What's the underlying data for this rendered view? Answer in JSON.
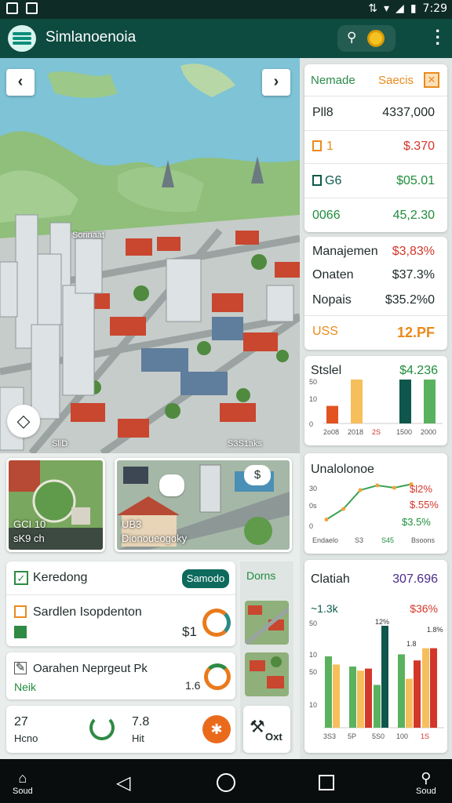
{
  "status_bar": {
    "time": "7:29"
  },
  "app": {
    "title": "Simlanoenoia"
  },
  "map": {
    "label_top": "Sorinaat",
    "label_bottom_left": "SliD",
    "label_bottom_right": "S3S1aks"
  },
  "summary_card": {
    "tab_left": "Nemade",
    "tab_right": "Saecis",
    "rows": [
      {
        "key": "Pll8",
        "value": "4337,000"
      },
      {
        "key": "1",
        "value": "$.370"
      },
      {
        "key": "G6",
        "value": "$05.01"
      },
      {
        "key": "0066",
        "value": "45,2.30"
      }
    ]
  },
  "finance_card": {
    "rows": [
      {
        "key": "Manajemen",
        "value": "$3,83%"
      },
      {
        "key": "Onaten",
        "value": "$37.3%"
      },
      {
        "key": "Nopais",
        "value": "$35.2%0"
      },
      {
        "key": "USS",
        "value": "12.PF"
      }
    ]
  },
  "bar_chart_card": {
    "chart_data": {
      "type": "bar",
      "title": "Stslel",
      "value_label": "$4.236",
      "categories": [
        "2o08",
        "2018",
        "2S",
        "1500",
        "2000"
      ],
      "values": [
        20,
        50,
        0,
        50,
        50
      ],
      "bar_colors": [
        "#e2531f",
        "#f6bf5c",
        "#ffffff",
        "#0f564c",
        "#5ab25e"
      ],
      "yticks": [
        "50",
        "10",
        "0"
      ]
    }
  },
  "line_chart_card": {
    "chart_data": {
      "type": "line",
      "title": "Unalolonoe",
      "x_labels": [
        "Endaelo",
        "S3",
        "S45",
        "Bsoons"
      ],
      "values": [
        5,
        14,
        30,
        34,
        32,
        35
      ],
      "yticks": [
        "30",
        "0s",
        "0"
      ],
      "annotations": [
        "$l2%",
        "$.55%",
        "$3.5%"
      ]
    }
  },
  "stacked_chart_card": {
    "chart_data": {
      "type": "bar",
      "title": "Clatiah",
      "value_right": "307.696",
      "sub_left": "~1.3k",
      "sub_right": "$36%",
      "categories": [
        "3S3",
        "5P",
        "5S0",
        "100",
        "1S"
      ],
      "yticks": [
        "50",
        "10",
        "50",
        "10"
      ],
      "top_labels": [
        "12%",
        "1.8",
        "1.8%"
      ],
      "series": [
        {
          "color": "#5ab25e",
          "values": [
            70,
            60,
            42,
            72,
            0
          ]
        },
        {
          "color": "#f6bf5c",
          "values": [
            62,
            56,
            0,
            48,
            78
          ]
        },
        {
          "color": "#d2372a",
          "values": [
            0,
            58,
            0,
            66,
            78
          ]
        },
        {
          "color": "#0f564c",
          "values": [
            0,
            0,
            100,
            0,
            0
          ]
        }
      ]
    }
  },
  "thumbs": {
    "left": {
      "line1": "GCI 10",
      "line2": "sK9 ch"
    },
    "middle": {
      "line1": "UB3",
      "line2": "Dionoueogoky"
    }
  },
  "list": {
    "header": {
      "label": "Keredong",
      "pill": "Samodo",
      "side": "Dorns"
    },
    "item1": {
      "title": "Sardlen Isopdenton",
      "value": "$1"
    },
    "item2": {
      "title": "Oarahen Neprgeut Pk",
      "sub": "Neik",
      "value": "1.6"
    },
    "item3": {
      "left_value": "27",
      "left_label": "Hcno",
      "mid_value": "7.8",
      "mid_label": "Hit"
    },
    "side_btn": "Oxt"
  },
  "bottom_nav": {
    "left_label": "Soud",
    "right_label": "Soud"
  }
}
